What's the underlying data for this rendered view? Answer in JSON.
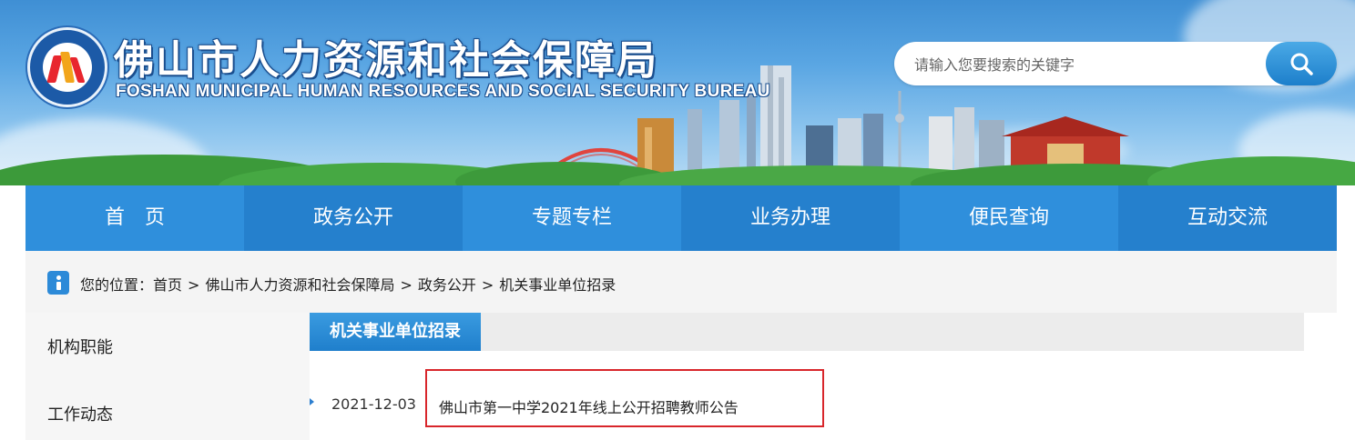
{
  "header": {
    "title": "佛山市人力资源和社会保障局",
    "subtitle": "FOSHAN MUNICIPAL HUMAN RESOURCES AND SOCIAL SECURITY BUREAU",
    "emblem_icon": "bureau-emblem-logo"
  },
  "search": {
    "placeholder": "请输入您要搜索的关键字",
    "button_icon": "search-icon"
  },
  "nav": {
    "items": [
      {
        "label": "首　页"
      },
      {
        "label": "政务公开"
      },
      {
        "label": "专题专栏"
      },
      {
        "label": "业务办理"
      },
      {
        "label": "便民查询"
      },
      {
        "label": "互动交流"
      }
    ]
  },
  "breadcrumb": {
    "prefix": "您的位置：",
    "items": [
      {
        "label": "首页"
      },
      {
        "label": "佛山市人力资源和社会保障局"
      },
      {
        "label": "政务公开"
      },
      {
        "label": "机关事业单位招录"
      }
    ],
    "separator": ">"
  },
  "sidebar": {
    "items": [
      {
        "label": "机构职能"
      },
      {
        "label": "工作动态"
      }
    ]
  },
  "section": {
    "title": "机关事业单位招录"
  },
  "articles": [
    {
      "date": "2021-12-03",
      "title": "佛山市第一中学2021年线上公开招聘教师公告"
    }
  ],
  "colors": {
    "nav_primary": "#2f8fdc",
    "nav_secondary": "#2580cd",
    "highlight_border": "#d8262b"
  }
}
